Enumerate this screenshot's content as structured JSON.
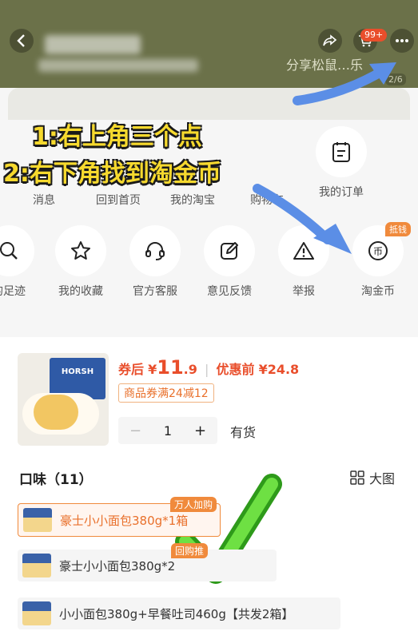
{
  "header": {
    "cart_badge": "99+",
    "share_hint": "分享松鼠…乐",
    "page_indicator": "2/6"
  },
  "menu": {
    "row1": [
      "消息",
      "回到首页",
      "我的淘宝",
      "购物车",
      "我的订单"
    ],
    "row2": [
      "的足迹",
      "我的收藏",
      "官方客服",
      "意见反馈",
      "举报",
      "淘金币"
    ],
    "earn_badge": "抵钱"
  },
  "annotations": {
    "step1": "1:右上角三个点",
    "step2": "2:右下角找到淘金币"
  },
  "product": {
    "price_after_label": "券后",
    "price_after_symbol": "¥",
    "price_after_int": "11",
    "price_after_dec": ".9",
    "separator": "|",
    "price_before_label": "优惠前",
    "price_before": "¥24.8",
    "coupon": "商品券满24减12",
    "qty": "1",
    "minus": "−",
    "plus": "+",
    "stock": "有货",
    "image_brand": "HORSH"
  },
  "flavor": {
    "title": "口味（11）",
    "big_view": "大图",
    "options": [
      {
        "label": "豪士小小面包380g*1箱",
        "tag": "万人加购"
      },
      {
        "label": "豪士小小面包380g*2",
        "tag": "回购推"
      },
      {
        "label": "小小面包380g+早餐吐司460g【共发2箱】",
        "tag": ""
      }
    ]
  },
  "colors": {
    "accent": "#e94e2b",
    "arrow": "#5b8ee6",
    "check": "#4fd12a",
    "annotation": "#f6d92e"
  }
}
